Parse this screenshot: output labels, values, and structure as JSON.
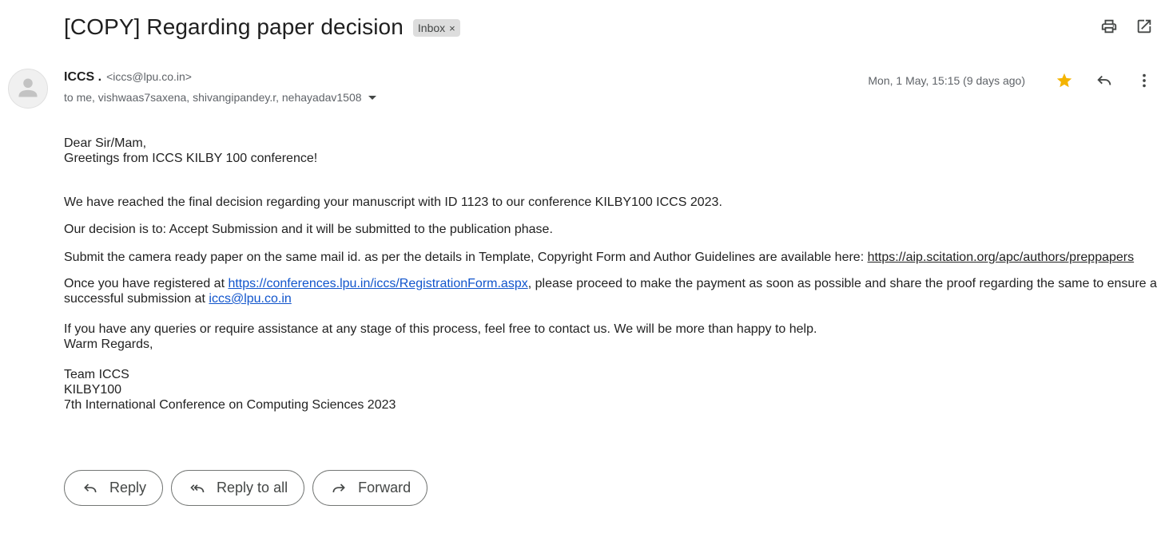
{
  "subject": "[COPY] Regarding paper decision",
  "label": {
    "name": "Inbox",
    "remove": "×"
  },
  "toolbar": {
    "print_icon": "print-icon",
    "popout_icon": "open-in-new-window-icon"
  },
  "sender": {
    "name": "ICCS .",
    "email": "<iccs@lpu.co.in>",
    "avatar_icon": "person-avatar-icon",
    "recipients": "to me, vishwaas7saxena, shivangipandey.r, nehayadav1508"
  },
  "meta": {
    "date": "Mon, 1 May, 15:15 (9 days ago)",
    "star_color": "#f4b400",
    "icons": [
      "star-icon",
      "reply-icon",
      "more-vert-icon"
    ]
  },
  "body": {
    "greeting": "Dear Sir/Mam,",
    "greeting2": "Greetings from ICCS KILBY 100 conference!",
    "p1": "We have reached the final decision regarding your manuscript with ID 1123  to our conference  KILBY100 ICCS 2023.",
    "p2": "Our decision is to: Accept Submission and it will be submitted to the publication phase.",
    "p3_text": "Submit the camera ready paper on the same mail id. as per the details in Template, Copyright Form and Author Guidelines are available here: ",
    "p3_link": "https://aip.scitation.org/apc/authors/preppapers",
    "p4_a": "Once you have registered at ",
    "p4_link": "https://conferences.lpu.in/iccs/RegistrationForm.aspx",
    "p4_b": ", please proceed to make the payment as soon as possible and share the proof regarding the same to ensure a successful submission at ",
    "p4_email": "iccs@lpu.co.in",
    "p5": "If you have any queries or require assistance at any stage of this process, feel free to contact us. We will be more than happy to help.",
    "closing": "Warm Regards,",
    "sig1": "Team ICCS",
    "sig2": "KILBY100",
    "sig3": "7th International Conference on Computing Sciences 2023"
  },
  "actions": {
    "reply": "Reply",
    "reply_all": "Reply to all",
    "forward": "Forward"
  },
  "link_color": "#1155cc"
}
